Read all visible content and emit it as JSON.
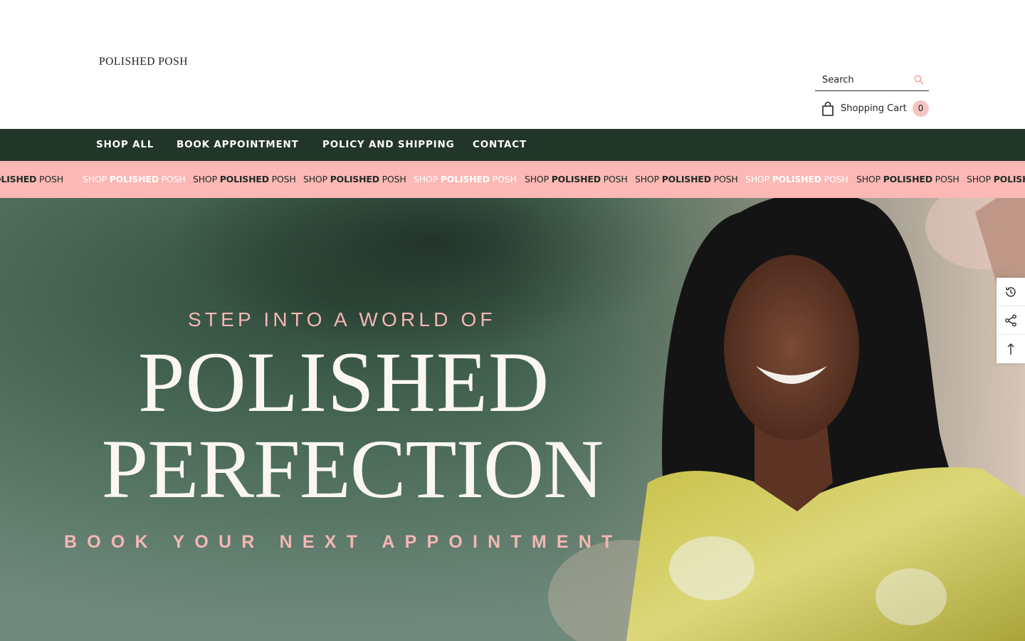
{
  "header": {
    "logo_text": "POLISHED POSH",
    "search": {
      "placeholder": "Search",
      "icon": "search-icon"
    },
    "cart": {
      "label": "Shopping Cart",
      "count": "0",
      "icon": "shopping-bag-icon"
    }
  },
  "nav": {
    "items": [
      {
        "label": "SHOP ALL"
      },
      {
        "label": "BOOK APPOINTMENT"
      },
      {
        "label": "POLICY AND SHIPPING"
      },
      {
        "label": "CONTACT"
      }
    ]
  },
  "marquee": {
    "partial_bold": "OLISHED",
    "partial_end": "POSH",
    "word_shop": "SHOP",
    "word_polished": "POLISHED",
    "word_posh": "POSH",
    "trailing_shop": "SHOP",
    "trailing_partial": "POLISH"
  },
  "hero": {
    "kicker": "STEP INTO A WORLD OF",
    "headline_line1": "POLISHED",
    "headline_line2": "PERFECTION",
    "cta": "BOOK YOUR NEXT APPOINTMENT"
  },
  "side_tools": {
    "items": [
      {
        "icon": "history-icon"
      },
      {
        "icon": "share-icon"
      },
      {
        "icon": "arrow-up-icon"
      }
    ]
  },
  "colors": {
    "nav_bg": "#223529",
    "marquee_bg": "#fbb8b5",
    "accent_pink": "#f4b7b3",
    "cart_badge": "#f6c4c1"
  }
}
